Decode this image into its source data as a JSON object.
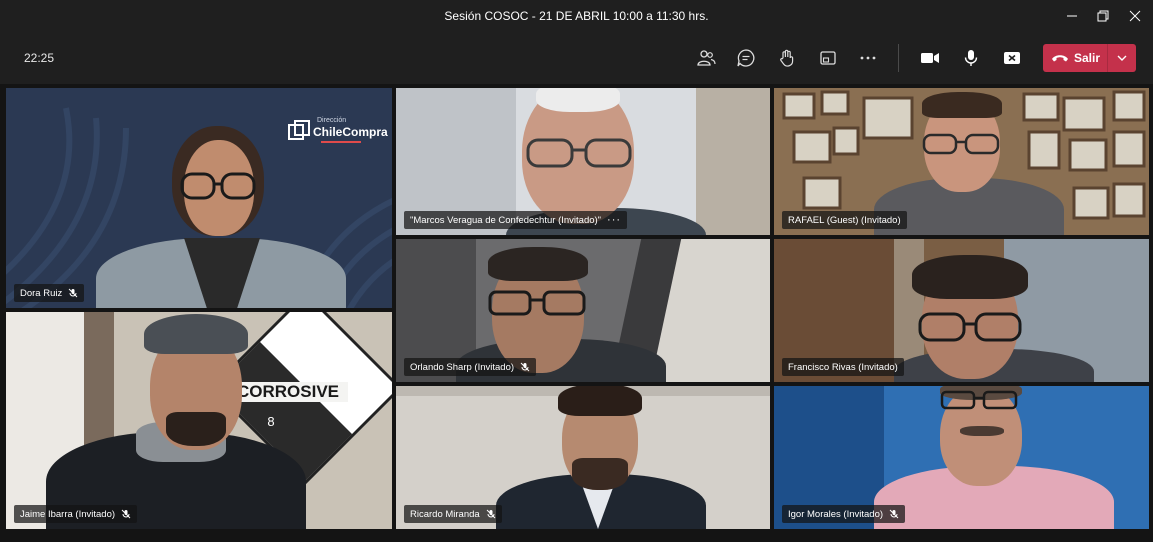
{
  "window": {
    "title": "Sesión COSOC - 21 DE ABRIL 10:00 a 11:30 hrs."
  },
  "toolbar": {
    "clock": "22:25",
    "leave_label": "Salir"
  },
  "logo": {
    "line1": "Dirección",
    "line2": "ChileCompra"
  },
  "sign_text": {
    "word": "CORROSIVE",
    "number": "8"
  },
  "participants": [
    {
      "name": "Dora Ruiz",
      "muted": true
    },
    {
      "name": "\"Marcos Veragua de Confedechtur (Invitado)\"",
      "muted": false,
      "more": "···"
    },
    {
      "name": "RAFAEL (Guest) (Invitado)",
      "muted": false
    },
    {
      "name": "Orlando Sharp (Invitado)",
      "muted": true
    },
    {
      "name": "Francisco Rivas (Invitado)",
      "muted": false
    },
    {
      "name": "Jaime Ibarra (Invitado)",
      "muted": true
    },
    {
      "name": "Ricardo Miranda",
      "muted": true
    },
    {
      "name": "Igor Morales (Invitado)",
      "muted": true
    }
  ],
  "colors": {
    "leave_red": "#c4314b",
    "chrome_bg": "#1f1f1f",
    "logo_bg": "#2b3953"
  }
}
